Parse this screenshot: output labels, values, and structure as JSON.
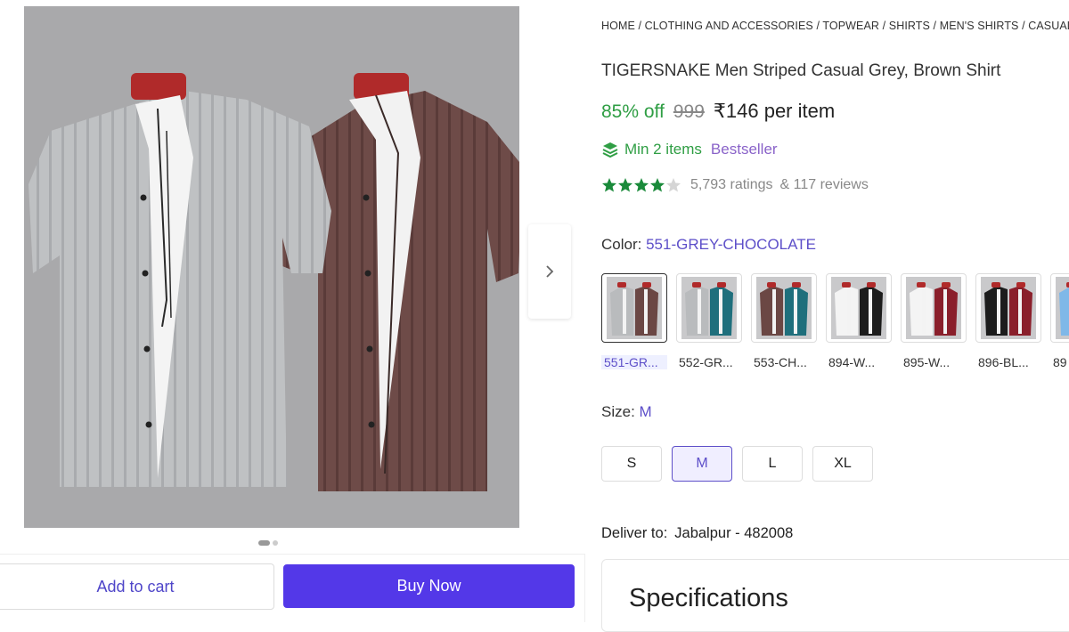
{
  "breadcrumb": [
    "HOME",
    "CLOTHING AND ACCESSORIES",
    "TOPWEAR",
    "SHIRTS",
    "MEN'S SHIRTS",
    "CASUAL SH"
  ],
  "product": {
    "title": "TIGERSNAKE Men Striped Casual Grey, Brown Shirt",
    "discount": "85% off",
    "mrp": "999",
    "price": "₹146 per item",
    "min_items": "Min 2 items",
    "badge": "Bestseller",
    "rating_value": 4,
    "rating_max": 5,
    "ratings": "5,793 ratings",
    "reviews": "& 117 reviews"
  },
  "gallery": {
    "image_count": 2,
    "active_index": 0,
    "next_icon": "chevron-right-icon"
  },
  "color": {
    "label": "Color:",
    "selected": "551-GREY-CHOCOLATE",
    "options": [
      {
        "label": "551-GR...",
        "c1": "#b9bbbd",
        "c2": "#6b4744"
      },
      {
        "label": "552-GR...",
        "c1": "#b9bbbd",
        "c2": "#1f6f7c"
      },
      {
        "label": "553-CH...",
        "c1": "#6b4744",
        "c2": "#1f6f7c"
      },
      {
        "label": "894-W...",
        "c1": "#f4f4f4",
        "c2": "#1c1c1c"
      },
      {
        "label": "895-W...",
        "c1": "#f4f4f4",
        "c2": "#8a1f2b"
      },
      {
        "label": "896-BL...",
        "c1": "#1c1c1c",
        "c2": "#8a1f2b"
      },
      {
        "label": "89",
        "c1": "#7fb8e8",
        "c2": "#7fb8e8"
      }
    ]
  },
  "size": {
    "label": "Size:",
    "selected": "M",
    "options": [
      "S",
      "M",
      "L",
      "XL"
    ]
  },
  "delivery": {
    "label": "Deliver to:",
    "location": "Jabalpur - 482008"
  },
  "actions": {
    "add_to_cart": "Add to cart",
    "buy_now": "Buy Now"
  },
  "specifications": {
    "title": "Specifications"
  },
  "colors": {
    "accent": "#5338e8",
    "green": "#2f9e44",
    "purple_text": "#5d4fc9",
    "star": "#1a8a3a"
  }
}
